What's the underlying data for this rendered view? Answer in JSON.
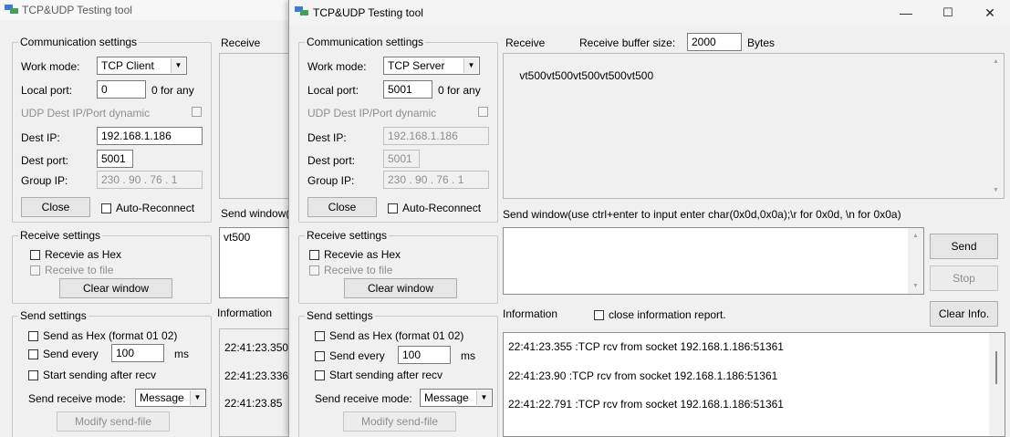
{
  "back": {
    "title": "TCP&UDP Testing tool",
    "comm": {
      "legend": "Communication settings",
      "work_mode_label": "Work mode:",
      "work_mode_value": "TCP Client",
      "local_port_label": "Local port:",
      "local_port_value": "0",
      "local_port_hint": "0 for any",
      "udp_dynamic_label": "UDP Dest IP/Port dynamic",
      "dest_ip_label": "Dest IP:",
      "dest_ip_value": "192.168.1.186",
      "dest_port_label": "Dest port:",
      "dest_port_value": "5001",
      "group_ip_label": "Group IP:",
      "group_ip_value": "230 . 90 . 76 . 1",
      "close_label": "Close",
      "auto_reconnect_label": "Auto-Reconnect"
    },
    "recv": {
      "legend": "Receive settings",
      "as_hex_label": "Recevie as Hex",
      "to_file_label": "Receive to file",
      "clear_label": "Clear window"
    },
    "send": {
      "legend": "Send settings",
      "as_hex_label": "Send as Hex (format 01 02)",
      "every_label": "Send every",
      "every_value": "100",
      "ms_label": "ms",
      "after_recv_label": "Start sending after recv",
      "mode_label": "Send receive mode:",
      "mode_value": "Message",
      "modify_label": "Modify send-file"
    },
    "receive_title": "Receive",
    "send_window_title": "Send window(",
    "send_text": "vt500",
    "info_title": "Information",
    "info_lines": [
      "22:41:23.350",
      "22:41:23.336",
      "22:41:23.85"
    ]
  },
  "front": {
    "title": "TCP&UDP Testing tool",
    "comm": {
      "legend": "Communication settings",
      "work_mode_label": "Work mode:",
      "work_mode_value": "TCP Server",
      "local_port_label": "Local port:",
      "local_port_value": "5001",
      "local_port_hint": "0 for any",
      "udp_dynamic_label": "UDP Dest IP/Port dynamic",
      "dest_ip_label": "Dest IP:",
      "dest_ip_value": "192.168.1.186",
      "dest_port_label": "Dest port:",
      "dest_port_value": "5001",
      "group_ip_label": "Group IP:",
      "group_ip_value": "230 . 90 . 76 . 1",
      "close_label": "Close",
      "auto_reconnect_label": "Auto-Reconnect"
    },
    "recv": {
      "legend": "Receive settings",
      "as_hex_label": "Recevie as Hex",
      "to_file_label": "Receive to file",
      "clear_label": "Clear window"
    },
    "send": {
      "legend": "Send settings",
      "as_hex_label": "Send as Hex (format 01 02)",
      "every_label": "Send every",
      "every_value": "100",
      "ms_label": "ms",
      "after_recv_label": "Start sending after recv",
      "mode_label": "Send receive mode:",
      "mode_value": "Message",
      "modify_label": "Modify send-file"
    },
    "receive_title": "Receive",
    "buffer_label": "Receive buffer size:",
    "buffer_value": "2000",
    "bytes_label": "Bytes",
    "receive_text": "vt500vt500vt500vt500vt500",
    "send_window_title": "Send window(use ctrl+enter to input enter char(0x0d,0x0a);\\r for 0x0d, \\n for 0x0a)",
    "send_button": "Send",
    "stop_button": "Stop",
    "info_title": "Information",
    "close_info_label": "close information report.",
    "clear_info_button": "Clear Info.",
    "info_lines": [
      "22:41:23.355 :TCP rcv from socket 192.168.1.186:51361",
      "22:41:23.90 :TCP rcv from socket 192.168.1.186:51361",
      "22:41:22.791 :TCP rcv from socket 192.168.1.186:51361"
    ],
    "window_controls": {
      "minimize": "—",
      "maximize": "☐",
      "close": "✕"
    }
  }
}
